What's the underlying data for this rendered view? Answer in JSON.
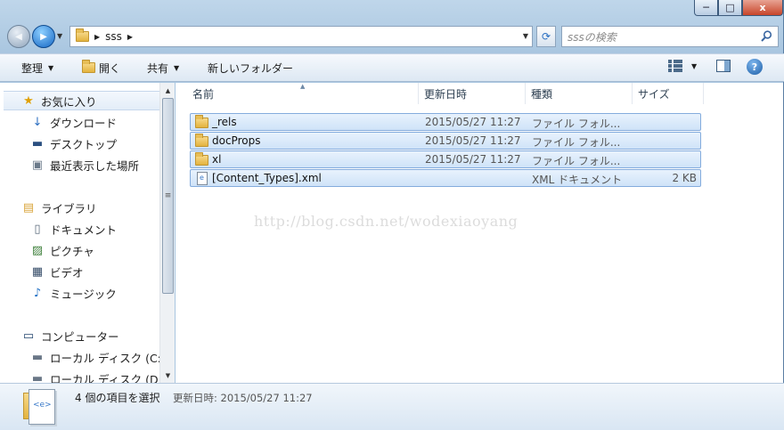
{
  "window": {
    "caption_buttons": {
      "minimize": "─",
      "maximize": "□",
      "close": "x"
    }
  },
  "address_bar": {
    "back_glyph": "◀",
    "forward_glyph": "▶",
    "crumb_arrow": "▶",
    "path_segment": "sss",
    "dropdown_glyph": "▼",
    "refresh_glyph": "⟳"
  },
  "search": {
    "placeholder": "sssの検索",
    "icon": "search-icon"
  },
  "toolbar": {
    "organize_label": "整理",
    "open_label": "開く",
    "share_label": "共有",
    "new_folder_label": "新しいフォルダー",
    "dropdown_glyph": "▼",
    "help_label": "?"
  },
  "nav_pane": {
    "items": [
      {
        "label": "お気に入り",
        "icon": "star-icon",
        "glyph": "★",
        "color": "#e0a000"
      },
      {
        "label": "ダウンロード",
        "icon": "download-folder-icon",
        "glyph": "↓",
        "color": "#2d6fc0"
      },
      {
        "label": "デスクトップ",
        "icon": "desktop-icon",
        "glyph": "▬",
        "color": "#2b4f80"
      },
      {
        "label": "最近表示した場所",
        "icon": "recent-places-icon",
        "glyph": "▣",
        "color": "#6b7a8a"
      },
      {
        "label": "ライブラリ",
        "icon": "libraries-icon",
        "glyph": "▤",
        "color": "#d9a53b"
      },
      {
        "label": "ドキュメント",
        "icon": "documents-icon",
        "glyph": "▯",
        "color": "#5b6b7c"
      },
      {
        "label": "ピクチャ",
        "icon": "pictures-icon",
        "glyph": "▨",
        "color": "#3d7f3a"
      },
      {
        "label": "ビデオ",
        "icon": "videos-icon",
        "glyph": "▦",
        "color": "#334a66"
      },
      {
        "label": "ミュージック",
        "icon": "music-icon",
        "glyph": "♪",
        "color": "#1f6fc4"
      },
      {
        "label": "コンピューター",
        "icon": "computer-icon",
        "glyph": "▭",
        "color": "#22456e"
      },
      {
        "label": "ローカル ディスク (C:",
        "icon": "disk-c-icon",
        "glyph": "▬",
        "color": "#6a7787"
      },
      {
        "label": "ローカル ディスク (D:",
        "icon": "disk-d-icon",
        "glyph": "▬",
        "color": "#6a7787"
      }
    ],
    "scroll_up": "▲",
    "scroll_down": "▼",
    "thumb_grip": "≡"
  },
  "columns": {
    "name": "名前",
    "modified": "更新日時",
    "type": "種類",
    "size": "サイズ",
    "sort_glyph": "▲"
  },
  "files": [
    {
      "name": "_rels",
      "modified": "2015/05/27 11:27",
      "type": "ファイル フォル...",
      "size": "",
      "icon": "folder-icon"
    },
    {
      "name": "docProps",
      "modified": "2015/05/27 11:27",
      "type": "ファイル フォル...",
      "size": "",
      "icon": "folder-icon"
    },
    {
      "name": "xl",
      "modified": "2015/05/27 11:27",
      "type": "ファイル フォル...",
      "size": "",
      "icon": "folder-icon"
    },
    {
      "name": "[Content_Types].xml",
      "modified": "",
      "type": "XML ドキュメント",
      "size": "2 KB",
      "icon": "xml-file-icon"
    }
  ],
  "watermark": "http://blog.csdn.net/wodexiaoyang",
  "status": {
    "selection_count": "4 個の項目を選択",
    "modified_label": "更新日時: 2015/05/27 11:27"
  }
}
